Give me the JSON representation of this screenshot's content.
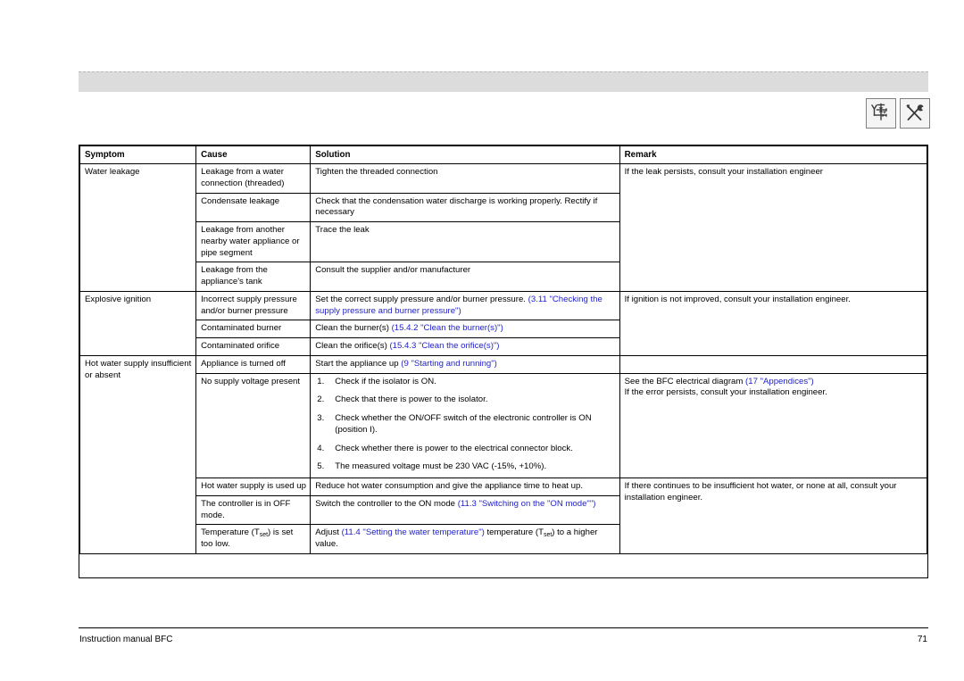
{
  "page": {
    "header_band": "",
    "footer_left": "Instruction manual BFC",
    "footer_page": "71",
    "link_color": "#2222cc"
  },
  "icons": [
    {
      "name": "piping-schematic-icon",
      "title": "Installation schematic"
    },
    {
      "name": "tools-icon",
      "title": "Service tools"
    }
  ],
  "table": {
    "headers": {
      "symptom": "Symptom",
      "cause": "Cause",
      "solution": "Solution",
      "remark": "Remark"
    },
    "rows": [
      {
        "symptom": "Water leakage",
        "cause": "Leakage from a water connection (threaded)",
        "solution": "Tighten the threaded connection",
        "remark": "If the leak persists, consult your installation engineer"
      },
      {
        "cause": "Condensate leakage",
        "solution": "Check that the condensation water discharge is working properly. Rectify if necessary"
      },
      {
        "cause": "Leakage from another nearby water appliance or pipe segment",
        "solution": "Trace the leak"
      },
      {
        "cause": "Leakage from the appliance's tank",
        "solution": "Consult the supplier and/or manufacturer"
      },
      {
        "symptom": "Explosive ignition",
        "cause": "Incorrect supply pressure and/or burner pressure",
        "solution_plain": "Set the correct supply pressure and/or burner pressure. ",
        "solution_link": "(3.11 \"Checking the supply pressure and burner pressure\")",
        "remark": "If ignition is not improved, consult your installation engineer."
      },
      {
        "cause": "Contaminated burner",
        "solution_plain": "Clean the burner(s) ",
        "solution_link": "(15.4.2 \"Clean the burner(s)\")"
      },
      {
        "cause": "Contaminated orifice",
        "solution_plain": "Clean the orifice(s) ",
        "solution_link": "(15.4.3 \"Clean the orifice(s)\")"
      },
      {
        "symptom": "Hot water supply insufficient or absent",
        "cause": "Appliance is turned off",
        "solution_plain": "Start the appliance up ",
        "solution_link": "(9 \"Starting and running\")",
        "remark": ""
      },
      {
        "cause": "No supply voltage present",
        "steps": [
          "Check if the isolator is ON.",
          "Check that there is power to the isolator.",
          "Check whether the ON/OFF switch of the electronic controller is ON (position I).",
          "Check whether there is power to the electrical connector block.",
          "The measured voltage must be 230 VAC (-15%, +10%)."
        ],
        "remark_plain_1": "See the BFC electrical diagram ",
        "remark_link": "(17 \"Appendices\")",
        "remark_plain_2": "If the error persists, consult your installation engineer."
      },
      {
        "cause": "Hot water supply is used up",
        "solution": "Reduce hot water consumption and give the appliance time to heat up.",
        "remark": "If there continues to be insufficient hot water, or none at all, consult your installation engineer."
      },
      {
        "cause": "The controller is in OFF mode.",
        "solution_plain": "Switch the controller to the ON mode ",
        "solution_link": "(11.3 \"Switching on the \"ON mode\"\")"
      },
      {
        "cause_pre": "Temperature (T",
        "cause_sub": "set",
        "cause_post": ") is set too low.",
        "solution_pre": "Adjust ",
        "solution_link": "(11.4 \"Setting the water temperature\")",
        "solution_mid": " temperature (T",
        "solution_sub": "set",
        "solution_post": ") to a higher value."
      }
    ]
  }
}
